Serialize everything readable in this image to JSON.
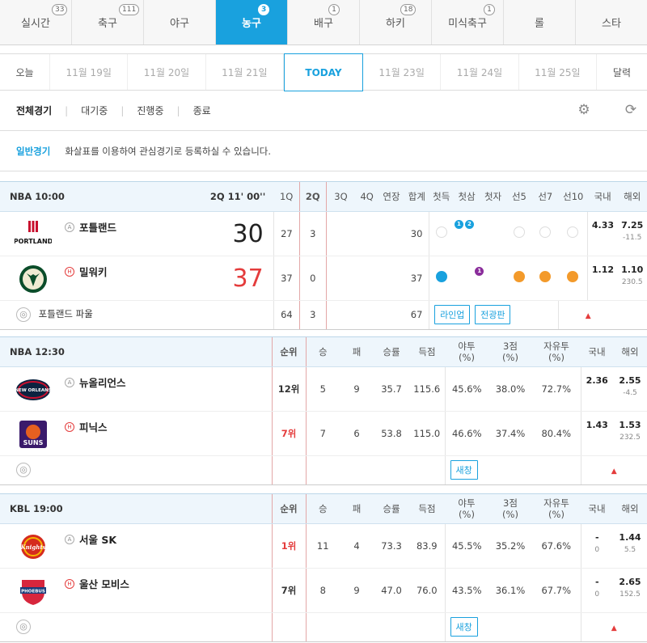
{
  "sport_tabs": [
    {
      "label": "실시간",
      "count": "33"
    },
    {
      "label": "축구",
      "count": "111"
    },
    {
      "label": "야구",
      "count": ""
    },
    {
      "label": "농구",
      "count": "3"
    },
    {
      "label": "배구",
      "count": "1"
    },
    {
      "label": "하키",
      "count": "18"
    },
    {
      "label": "미식축구",
      "count": "1"
    },
    {
      "label": "롤",
      "count": ""
    },
    {
      "label": "스타",
      "count": ""
    }
  ],
  "dates": {
    "today_btn": "오늘",
    "d1": "11월 19일",
    "d2": "11월 20일",
    "d3": "11월 21일",
    "today": "TODAY",
    "d5": "11월 23일",
    "d6": "11월 24일",
    "d7": "11월 25일",
    "calendar": "달력"
  },
  "filters": {
    "all": "전체경기",
    "waiting": "대기중",
    "live": "진행중",
    "ended": "종료"
  },
  "notice": {
    "label": "일반경기",
    "text": "화살표를 이용하여 관심경기로 등록하실 수 있습니다."
  },
  "game1": {
    "league_time": "NBA  10:00",
    "status": "2Q 11' 00''",
    "cols": [
      "1Q",
      "2Q",
      "3Q",
      "4Q",
      "연장",
      "합계",
      "첫득",
      "첫삼",
      "첫자",
      "선5",
      "선7",
      "선10",
      "국내",
      "해외"
    ],
    "away": {
      "name": "포틀랜드",
      "ha": "A",
      "score": "30",
      "q1": "27",
      "q2": "3",
      "total": "30",
      "dom": "4.33",
      "intl": "7.25",
      "intl_sub": "-11.5",
      "mini1": "1",
      "mini2": "2"
    },
    "home": {
      "name": "밀워키",
      "ha": "H",
      "score": "37",
      "q1": "37",
      "q2": "0",
      "total": "37",
      "dom": "1.12",
      "intl": "1.10",
      "intl_sub": "230.5",
      "mini": "1"
    },
    "foot": {
      "label": "포틀랜드 파울",
      "q1": "64",
      "q2": "3",
      "total": "67",
      "btn1": "라인업",
      "btn2": "전광판"
    }
  },
  "game2": {
    "league_time": "NBA  12:30",
    "cols": [
      "순위",
      "승",
      "패",
      "승률",
      "득점",
      "야투\n(%)",
      "3점\n(%)",
      "자유투\n(%)",
      "국내",
      "해외"
    ],
    "away": {
      "name": "뉴올리언스",
      "ha": "A",
      "rank": "12위",
      "w": "5",
      "l": "9",
      "pct": "35.7",
      "pts": "115.6",
      "fg": "45.6%",
      "tp": "38.0%",
      "ft": "72.7%",
      "dom": "2.36",
      "intl": "2.55",
      "intl_sub": "-4.5"
    },
    "home": {
      "name": "피닉스",
      "ha": "H",
      "rank": "7위",
      "w": "7",
      "l": "6",
      "pct": "53.8",
      "pts": "115.0",
      "fg": "46.6%",
      "tp": "37.4%",
      "ft": "80.4%",
      "dom": "1.43",
      "intl": "1.53",
      "intl_sub": "232.5"
    },
    "btn": "새창"
  },
  "game3": {
    "league_time": "KBL  19:00",
    "cols": [
      "순위",
      "승",
      "패",
      "승률",
      "득점",
      "야투\n(%)",
      "3점\n(%)",
      "자유투\n(%)",
      "국내",
      "해외"
    ],
    "away": {
      "name": "서울 SK",
      "ha": "A",
      "rank": "1위",
      "w": "11",
      "l": "4",
      "pct": "73.3",
      "pts": "83.9",
      "fg": "45.5%",
      "tp": "35.2%",
      "ft": "67.6%",
      "dom": "-",
      "dom_sub": "0",
      "intl": "1.44",
      "intl_sub": "5.5"
    },
    "home": {
      "name": "울산 모비스",
      "ha": "H",
      "rank": "7위",
      "w": "8",
      "l": "9",
      "pct": "47.0",
      "pts": "76.0",
      "fg": "43.5%",
      "tp": "36.1%",
      "ft": "67.7%",
      "dom": "-",
      "dom_sub": "0",
      "intl": "2.65",
      "intl_sub": "152.5"
    },
    "btn": "새창"
  },
  "logos": {
    "portland": "PORTLAND",
    "newOrleans": "NEW ORLEANS",
    "phoenix": "SUNS",
    "sk": "Knights",
    "mobis": "PHOEBUS"
  },
  "colors": {
    "accent": "#19a1de",
    "red": "#e43c3c",
    "orange": "#f39a2b"
  }
}
